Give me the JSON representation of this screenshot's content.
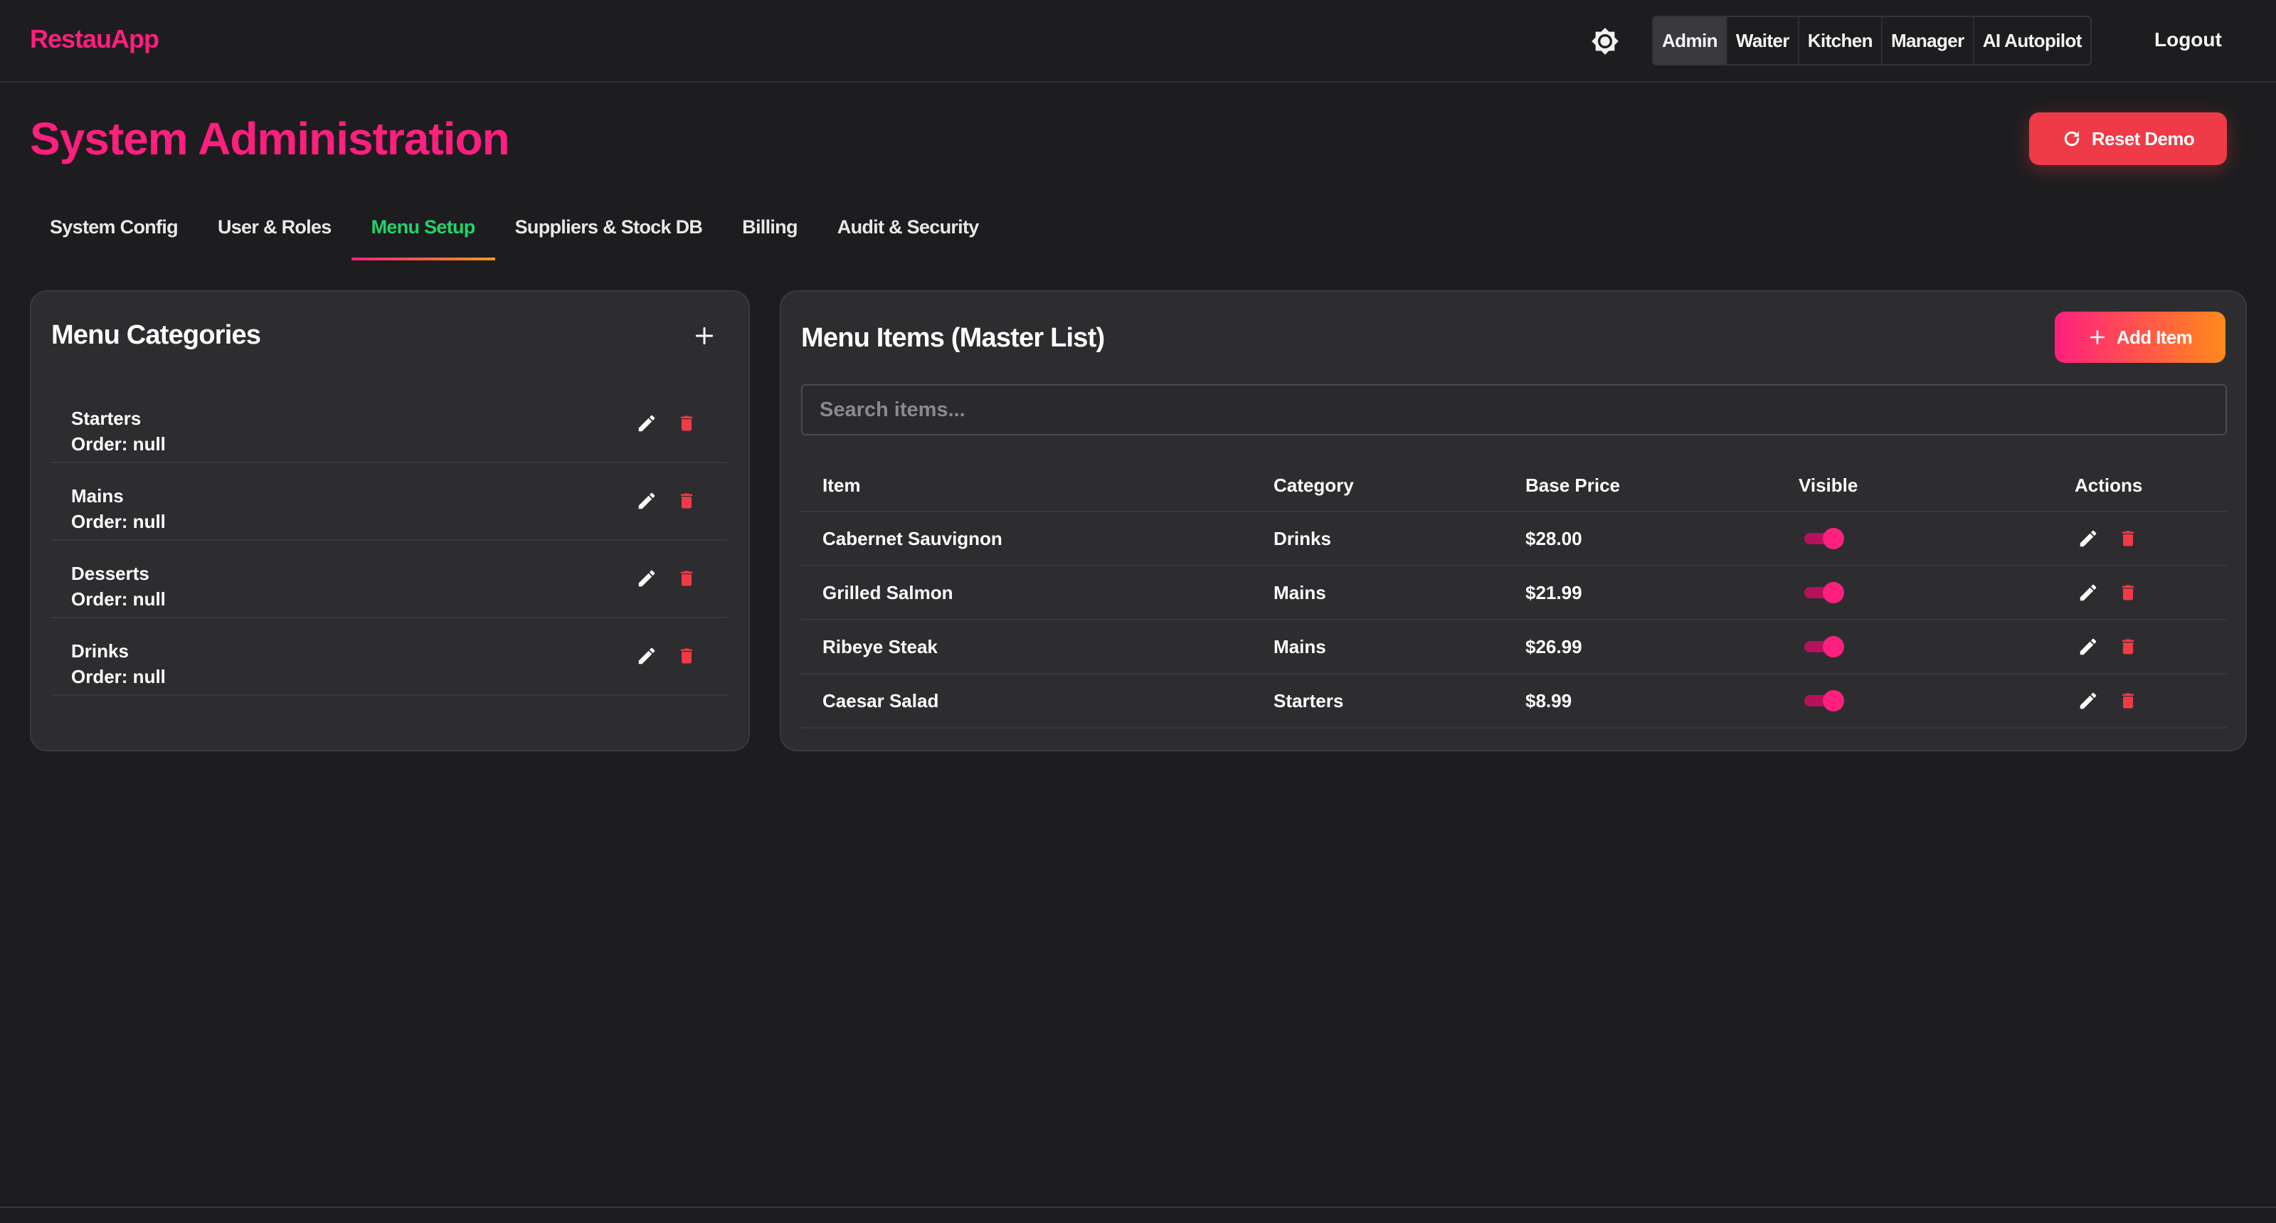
{
  "app": {
    "brand": "RestauApp"
  },
  "header": {
    "roles": [
      {
        "label": "Admin",
        "active": true
      },
      {
        "label": "Waiter",
        "active": false
      },
      {
        "label": "Kitchen",
        "active": false
      },
      {
        "label": "Manager",
        "active": false
      },
      {
        "label": "AI Autopilot",
        "active": false
      }
    ],
    "logout_label": "Logout",
    "theme_icon": "brightness-icon"
  },
  "page": {
    "title": "System Administration",
    "reset_label": "Reset Demo"
  },
  "tabs": [
    {
      "label": "System Config",
      "active": false
    },
    {
      "label": "User & Roles",
      "active": false
    },
    {
      "label": "Menu Setup",
      "active": true
    },
    {
      "label": "Suppliers & Stock DB",
      "active": false
    },
    {
      "label": "Billing",
      "active": false
    },
    {
      "label": "Audit & Security",
      "active": false
    }
  ],
  "categories": {
    "title": "Menu Categories",
    "items": [
      {
        "name": "Starters",
        "order": "Order: null"
      },
      {
        "name": "Mains",
        "order": "Order: null"
      },
      {
        "name": "Desserts",
        "order": "Order: null"
      },
      {
        "name": "Drinks",
        "order": "Order: null"
      }
    ]
  },
  "menu_items": {
    "title": "Menu Items (Master List)",
    "add_label": "Add Item",
    "search_placeholder": "Search items...",
    "columns": [
      "Item",
      "Category",
      "Base Price",
      "Visible",
      "Actions"
    ],
    "rows": [
      {
        "item": "Cabernet Sauvignon",
        "category": "Drinks",
        "price": "$28.00",
        "visible": true
      },
      {
        "item": "Grilled Salmon",
        "category": "Mains",
        "price": "$21.99",
        "visible": true
      },
      {
        "item": "Ribeye Steak",
        "category": "Mains",
        "price": "$26.99",
        "visible": true
      },
      {
        "item": "Caesar Salad",
        "category": "Starters",
        "price": "$8.99",
        "visible": true
      }
    ]
  },
  "colors": {
    "accent": "#ff1f7e",
    "active_tab": "#22d36b",
    "danger": "#ef3b47",
    "gradient_end": "#ff8a1a"
  }
}
